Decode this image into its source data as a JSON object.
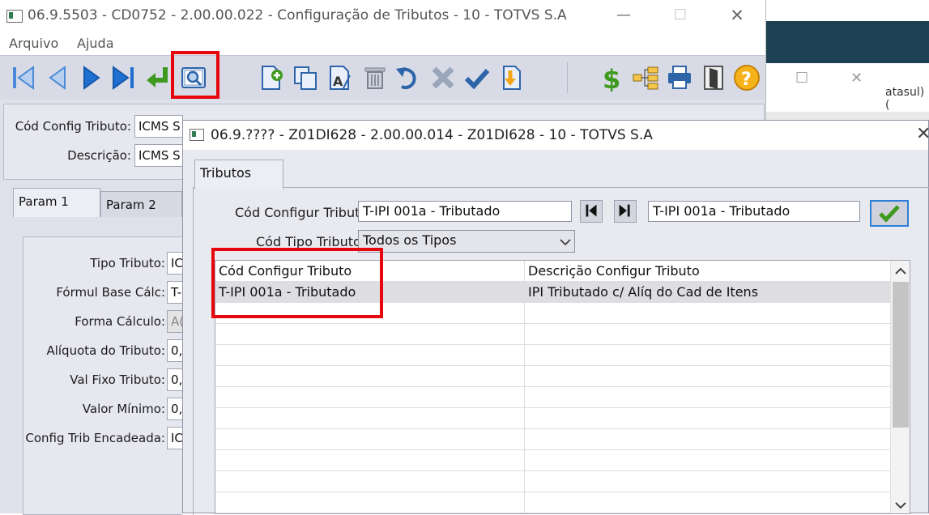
{
  "main_window": {
    "title": "06.9.5503 - CD0752 - 2.00.00.022 - Configuração de Tributos - 10 - TOTVS S.A",
    "controls": {
      "minimize": "—",
      "maximize": "☐",
      "close": "✕"
    },
    "menu": [
      "Arquivo",
      "Ajuda"
    ],
    "toolbar": {
      "icons": [
        "first-record-icon",
        "previous-record-icon",
        "next-record-icon",
        "last-record-icon",
        "goto-icon",
        "search-icon",
        "new-record-icon",
        "copy-icon",
        "edit-icon",
        "delete-icon",
        "undo-icon",
        "cancel-icon",
        "save-icon",
        "import-icon",
        "currency-icon",
        "tree-icon",
        "print-icon",
        "exit-icon",
        "help-icon"
      ]
    },
    "header": {
      "cod_label": "Cód Config Tributo:",
      "cod_value": "ICMS S",
      "desc_label": "Descrição:",
      "desc_value": "ICMS S"
    },
    "tabs": [
      "Param 1",
      "Param 2"
    ],
    "params": [
      {
        "label": "Tipo Tributo:",
        "value": "IC"
      },
      {
        "label": "Fórmul Base Cálc:",
        "value": "T-"
      },
      {
        "label": "Forma Cálculo:",
        "value": "A("
      },
      {
        "label": "Alíquota do Tributo:",
        "value": "0,"
      },
      {
        "label": "Val Fixo Tributo:",
        "value": "0,"
      },
      {
        "label": "Valor Mínimo:",
        "value": "0,"
      },
      {
        "label": "Config Trib Encadeada:",
        "value": "IC"
      }
    ]
  },
  "background_window": {
    "controls": {
      "maximize": "☐",
      "close": "✕"
    },
    "partial_text": "atasul) ("
  },
  "dialog": {
    "title": "06.9.???? - Z01DI628 - 2.00.00.014 - Z01DI628 - 10 - TOTVS S.A",
    "close": "✕",
    "tab": "Tributos",
    "cod_label": "Cód Configur Tributo:",
    "cod_from": "T-IPI 001a - Tributado",
    "cod_to": "T-IPI 001a - Tributado",
    "tipo_label": "Cód Tipo Tributo:",
    "tipo_value": "Todos os Tipos",
    "grid": {
      "columns": [
        "Cód Configur Tributo",
        "Descrição Configur Tributo"
      ],
      "rows": [
        [
          "T-IPI 001a - Tributado",
          "IPI Tributado c/ Alíq do Cad de Itens"
        ]
      ]
    }
  },
  "colors": {
    "annotation": "#e6060c",
    "accent": "#1e6fc0"
  }
}
